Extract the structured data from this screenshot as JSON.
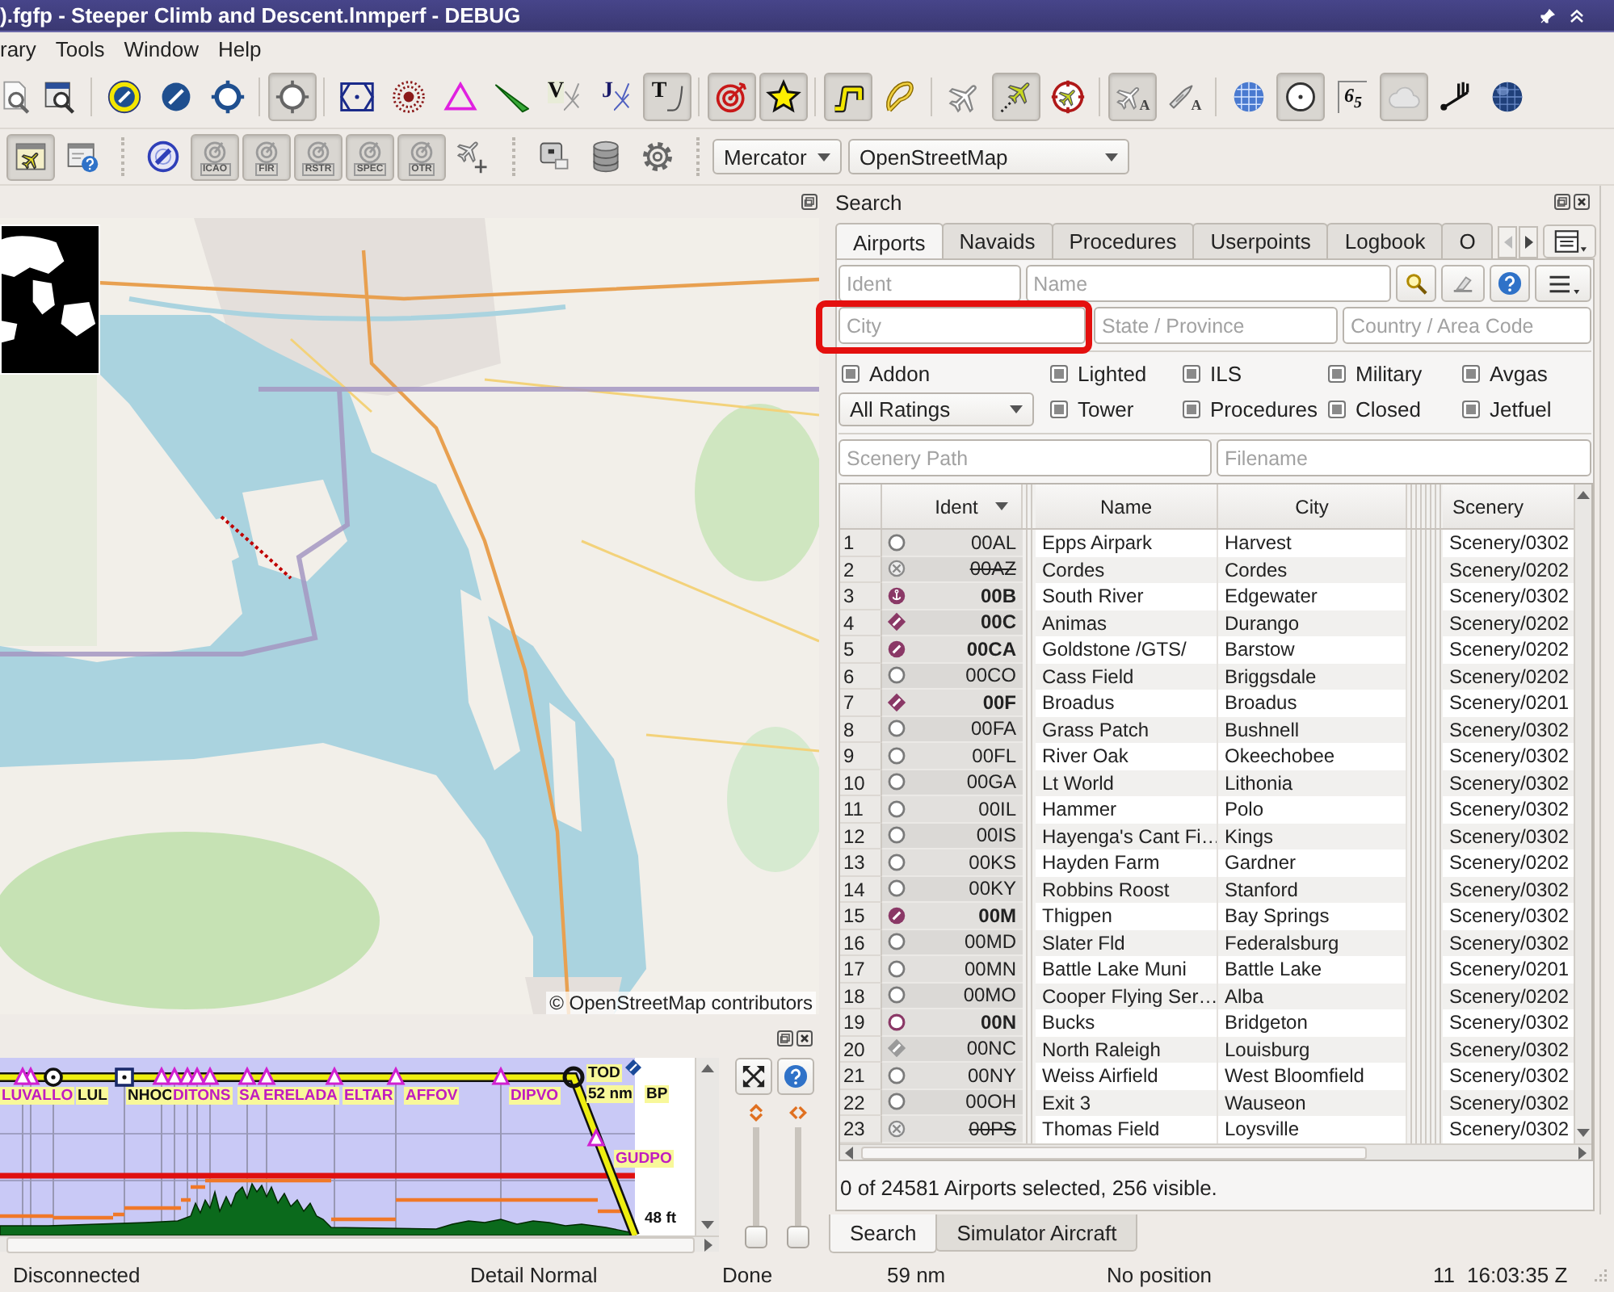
{
  "window": {
    "title": ").fgfp - Steeper Climb and Descent.lnmperf - DEBUG"
  },
  "menu": [
    "rary",
    "Tools",
    "Window",
    "Help"
  ],
  "toolbar_1": [
    {
      "kind": "button",
      "pressed": false
    },
    {
      "kind": "button",
      "pressed": false
    },
    {
      "kind": "separator"
    },
    {
      "kind": "button",
      "pressed": false
    },
    {
      "kind": "button",
      "pressed": false
    },
    {
      "kind": "button",
      "pressed": false
    },
    {
      "kind": "separator"
    },
    {
      "kind": "button",
      "pressed": true
    },
    {
      "kind": "separator"
    },
    {
      "kind": "button",
      "pressed": false
    },
    {
      "kind": "button",
      "pressed": false
    },
    {
      "kind": "button",
      "pressed": false
    },
    {
      "kind": "button",
      "pressed": false
    },
    {
      "kind": "button",
      "pressed": false,
      "glyph": "V"
    },
    {
      "kind": "button",
      "pressed": false,
      "glyph": "J"
    },
    {
      "kind": "button",
      "pressed": true,
      "glyph": "T"
    },
    {
      "kind": "separator"
    },
    {
      "kind": "button",
      "pressed": true
    },
    {
      "kind": "button",
      "pressed": true
    },
    {
      "kind": "separator"
    },
    {
      "kind": "button",
      "pressed": true
    },
    {
      "kind": "button",
      "pressed": false
    },
    {
      "kind": "separator"
    },
    {
      "kind": "button",
      "pressed": false
    },
    {
      "kind": "button",
      "pressed": true
    },
    {
      "kind": "button",
      "pressed": false
    },
    {
      "kind": "separator"
    },
    {
      "kind": "button",
      "pressed": true,
      "glyph": "A"
    },
    {
      "kind": "button",
      "pressed": false,
      "glyph": "A"
    },
    {
      "kind": "separator"
    },
    {
      "kind": "button",
      "pressed": false
    },
    {
      "kind": "button",
      "pressed": true
    },
    {
      "kind": "button",
      "pressed": false,
      "glyph": "6$_{5}$"
    },
    {
      "kind": "button",
      "pressed": true
    },
    {
      "kind": "button",
      "pressed": false
    },
    {
      "kind": "button",
      "pressed": false
    }
  ],
  "toolbar_2": [
    {
      "kind": "button",
      "pressed": true
    },
    {
      "kind": "button",
      "pressed": false
    },
    {
      "kind": "separator"
    },
    {
      "kind": "button",
      "pressed": false
    },
    {
      "kind": "button",
      "pressed": true,
      "glyph": "ICAO"
    },
    {
      "kind": "button",
      "pressed": true,
      "glyph": "FIR"
    },
    {
      "kind": "button",
      "pressed": true,
      "glyph": "RSTR"
    },
    {
      "kind": "button",
      "pressed": true,
      "glyph": "SPEC"
    },
    {
      "kind": "button",
      "pressed": true,
      "glyph": "OTR"
    },
    {
      "kind": "button",
      "pressed": false
    },
    {
      "kind": "separator"
    },
    {
      "kind": "button",
      "pressed": false
    },
    {
      "kind": "button",
      "pressed": false
    },
    {
      "kind": "button",
      "pressed": false
    },
    {
      "kind": "separator"
    },
    {
      "kind": "combo",
      "value": "Mercator"
    },
    {
      "kind": "combo",
      "value": "OpenStreetMap"
    }
  ],
  "map": {
    "attribution": "© OpenStreetMap contributors"
  },
  "profile": {
    "waypoints": [
      {
        "label": "LUVALLO",
        "kind": "waypoint"
      },
      {
        "label": "LUL",
        "kind": "vor"
      },
      {
        "label": "NHOC",
        "kind": "ndb"
      },
      {
        "label": "DITONS",
        "kind": "waypoint"
      },
      {
        "label": "SA",
        "kind": "waypoint"
      },
      {
        "label": "ERELADA",
        "kind": "waypoint"
      },
      {
        "label": "ELTAR",
        "kind": "waypoint"
      },
      {
        "label": "AFFOV",
        "kind": "waypoint"
      },
      {
        "label": "DIPVO",
        "kind": "waypoint"
      },
      {
        "label": "GUDPO",
        "kind": "waypoint"
      }
    ],
    "top_of_descent": {
      "label": "TOD",
      "distance": "52 nm"
    },
    "userpoint": {
      "label": "BP"
    },
    "elevation": "48 ft",
    "sliders": [
      {
        "level": 0
      },
      {
        "level": 0
      }
    ]
  },
  "search": {
    "title": "Search",
    "tabs": [
      {
        "label": "Airports",
        "selected": true
      },
      {
        "label": "Navaids",
        "selected": false
      },
      {
        "label": "Procedures",
        "selected": false
      },
      {
        "label": "Userpoints",
        "selected": false
      },
      {
        "label": "Logbook",
        "selected": false
      },
      {
        "label": "O",
        "selected": false
      }
    ],
    "fields_1": [
      {
        "placeholder": "Ident",
        "highlighted": false
      },
      {
        "placeholder": "Name",
        "highlighted": false
      }
    ],
    "fields_2": [
      {
        "placeholder": "City",
        "highlighted": true
      },
      {
        "placeholder": "State / Province",
        "highlighted": false
      },
      {
        "placeholder": "Country / Area Code",
        "highlighted": false
      }
    ],
    "filters": [
      {
        "kind": "checkbox",
        "label": "Addon",
        "indeterminate": true
      },
      {
        "kind": "checkbox",
        "label": "Lighted",
        "indeterminate": true
      },
      {
        "kind": "checkbox",
        "label": "ILS",
        "indeterminate": true
      },
      {
        "kind": "checkbox",
        "label": "Military",
        "indeterminate": true
      },
      {
        "kind": "checkbox",
        "label": "Avgas",
        "indeterminate": true
      },
      {
        "kind": "combo",
        "value": "All Ratings"
      },
      {
        "kind": "checkbox",
        "label": "Tower",
        "indeterminate": true
      },
      {
        "kind": "checkbox",
        "label": "Procedures",
        "indeterminate": true
      },
      {
        "kind": "checkbox",
        "label": "Closed",
        "indeterminate": true
      },
      {
        "kind": "checkbox",
        "label": "Jetfuel",
        "indeterminate": true
      }
    ],
    "fields_3": [
      {
        "placeholder": "Scenery Path",
        "highlighted": false
      },
      {
        "placeholder": "Filename",
        "highlighted": false
      }
    ],
    "table": {
      "columns": [
        {
          "label": "Ident",
          "sorted": true
        },
        {
          "label": "Name",
          "sorted": false
        },
        {
          "label": "City",
          "sorted": false
        },
        {
          "label": "Scenery",
          "sorted": false
        }
      ],
      "rows": [
        {
          "number": "1",
          "kind": "soft",
          "ident": "00AL",
          "name": "Epps Airpark",
          "city": "Harvest",
          "scenery": "Scenery/0302"
        },
        {
          "number": "2",
          "kind": "closed",
          "ident": "00AZ",
          "name": "Cordes",
          "city": "Cordes",
          "scenery": "Scenery/0202"
        },
        {
          "number": "3",
          "kind": "water",
          "ident": "00B",
          "name": "South River",
          "city": "Edgewater",
          "scenery": "Scenery/0302"
        },
        {
          "number": "4",
          "kind": "hardlong",
          "ident": "00C",
          "name": "Animas",
          "city": "Durango",
          "scenery": "Scenery/0202"
        },
        {
          "number": "5",
          "kind": "hard",
          "ident": "00CA",
          "name": "Goldstone /GTS/",
          "city": "Barstow",
          "scenery": "Scenery/0202"
        },
        {
          "number": "6",
          "kind": "soft",
          "ident": "00CO",
          "name": "Cass Field",
          "city": "Briggsdale",
          "scenery": "Scenery/0202"
        },
        {
          "number": "7",
          "kind": "hardlong",
          "ident": "00F",
          "name": "Broadus",
          "city": "Broadus",
          "scenery": "Scenery/0201"
        },
        {
          "number": "8",
          "kind": "soft",
          "ident": "00FA",
          "name": "Grass Patch",
          "city": "Bushnell",
          "scenery": "Scenery/0302"
        },
        {
          "number": "9",
          "kind": "soft",
          "ident": "00FL",
          "name": "River Oak",
          "city": "Okeechobee",
          "scenery": "Scenery/0302"
        },
        {
          "number": "10",
          "kind": "soft",
          "ident": "00GA",
          "name": "Lt World",
          "city": "Lithonia",
          "scenery": "Scenery/0302"
        },
        {
          "number": "11",
          "kind": "soft",
          "ident": "00IL",
          "name": "Hammer",
          "city": "Polo",
          "scenery": "Scenery/0302"
        },
        {
          "number": "12",
          "kind": "soft",
          "ident": "00IS",
          "name": "Hayenga's Cant Fi…",
          "city": "Kings",
          "scenery": "Scenery/0302"
        },
        {
          "number": "13",
          "kind": "soft",
          "ident": "00KS",
          "name": "Hayden Farm",
          "city": "Gardner",
          "scenery": "Scenery/0202"
        },
        {
          "number": "14",
          "kind": "soft",
          "ident": "00KY",
          "name": "Robbins Roost",
          "city": "Stanford",
          "scenery": "Scenery/0302"
        },
        {
          "number": "15",
          "kind": "hard",
          "ident": "00M",
          "name": "Thigpen",
          "city": "Bay Springs",
          "scenery": "Scenery/0302"
        },
        {
          "number": "16",
          "kind": "soft",
          "ident": "00MD",
          "name": "Slater Fld",
          "city": "Federalsburg",
          "scenery": "Scenery/0302"
        },
        {
          "number": "17",
          "kind": "soft",
          "ident": "00MN",
          "name": "Battle Lake Muni",
          "city": "Battle Lake",
          "scenery": "Scenery/0201"
        },
        {
          "number": "18",
          "kind": "soft",
          "ident": "00MO",
          "name": "Cooper Flying Ser…",
          "city": "Alba",
          "scenery": "Scenery/0202"
        },
        {
          "number": "19",
          "kind": "ring",
          "ident": "00N",
          "name": "Bucks",
          "city": "Bridgeton",
          "scenery": "Scenery/0302"
        },
        {
          "number": "20",
          "kind": "softlong",
          "ident": "00NC",
          "name": "North Raleigh",
          "city": "Louisburg",
          "scenery": "Scenery/0302"
        },
        {
          "number": "21",
          "kind": "soft",
          "ident": "00NY",
          "name": "Weiss Airfield",
          "city": "West Bloomfield",
          "scenery": "Scenery/0302"
        },
        {
          "number": "22",
          "kind": "soft",
          "ident": "00OH",
          "name": "Exit 3",
          "city": "Wauseon",
          "scenery": "Scenery/0302"
        },
        {
          "number": "23",
          "kind": "closed",
          "ident": "00PS",
          "name": "Thomas Field",
          "city": "Loysville",
          "scenery": "Scenery/0302"
        }
      ]
    },
    "summary": "0 of 24581 Airports selected, 256 visible."
  },
  "dock_tabs": [
    {
      "label": "Search",
      "selected": true
    },
    {
      "label": "Simulator Aircraft",
      "selected": false
    }
  ],
  "status_bar": [
    "Disconnected",
    "Detail Normal",
    "Done",
    "59 nm",
    "No position",
    "11",
    "16:03:35 Z"
  ]
}
